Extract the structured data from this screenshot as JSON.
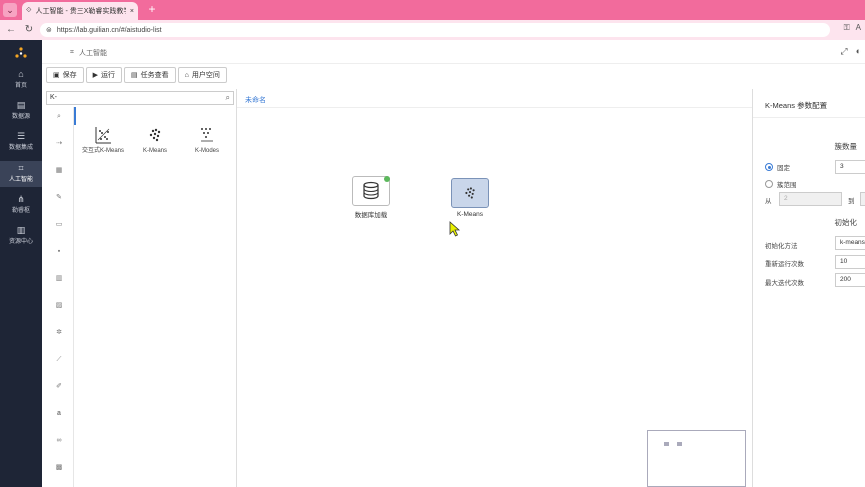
{
  "browser": {
    "tab_title": "人工智能 - 贵三X勒睿实践教学平台",
    "url": "https://lab.guilian.cn/#/aistudio-list",
    "new_tab": "+",
    "tab_close": "×"
  },
  "sidebar": {
    "items": [
      {
        "label": "首页",
        "icon": "home-icon"
      },
      {
        "label": "数据源",
        "icon": "database-icon"
      },
      {
        "label": "数据集成",
        "icon": "stack-icon"
      },
      {
        "label": "人工智能",
        "icon": "ai-icon",
        "active": true
      },
      {
        "label": "勒睿枢",
        "icon": "network-icon"
      },
      {
        "label": "资源中心",
        "icon": "book-icon"
      }
    ]
  },
  "header": {
    "title": "人工智能"
  },
  "toolbar": {
    "save": "保存",
    "run": "运行",
    "tasks": "任务查看",
    "user_space": "用户空间"
  },
  "left_panel": {
    "search_value": "K-",
    "algorithms": [
      {
        "label": "交互式K-Means",
        "icon": "interactive-kmeans-icon"
      },
      {
        "label": "K-Means",
        "icon": "kmeans-icon"
      },
      {
        "label": "K-Modes",
        "icon": "kmodes-icon"
      }
    ]
  },
  "canvas": {
    "tab_label": "未命名",
    "nodes": [
      {
        "label": "数据库加载",
        "icon": "database-icon",
        "selected": false
      },
      {
        "label": "K-Means",
        "icon": "kmeans-icon",
        "selected": true
      }
    ]
  },
  "config": {
    "title": "K-Means 参数配置",
    "cluster_section": "簇数量",
    "fixed_label": "固定",
    "fixed_value": "3",
    "range_label": "簇范围",
    "from_label": "从",
    "from_value": "2",
    "to_label": "到",
    "init_section": "初始化",
    "init_method_label": "初始化方法",
    "init_method_value": "k-means",
    "rerun_label": "重新运行次数",
    "rerun_value": "10",
    "max_iter_label": "最大迭代次数",
    "max_iter_value": "200"
  },
  "colors": {
    "titlebar": "#f26b9c",
    "sidebar": "#1e2536",
    "accent": "#3a7bd5"
  }
}
